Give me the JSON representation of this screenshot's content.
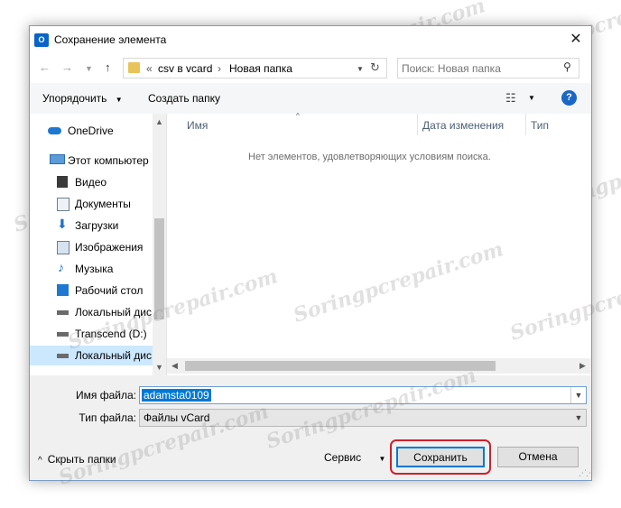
{
  "window": {
    "title": "Сохранение элемента",
    "app_icon": "O",
    "close_glyph": "✕"
  },
  "address": {
    "prefix": "«",
    "crumbs": [
      "csv в vcard",
      "Новая папка"
    ],
    "separator": "›",
    "search_placeholder": "Поиск: Новая папка"
  },
  "toolbar": {
    "organize": "Упорядочить",
    "new_folder": "Создать папку"
  },
  "sidebar": {
    "items": [
      {
        "label": "OneDrive",
        "icon": "cloud-icon"
      },
      {
        "label": "Этот компьютер",
        "icon": "computer-icon"
      },
      {
        "label": "Видео",
        "icon": "video-icon"
      },
      {
        "label": "Документы",
        "icon": "documents-icon"
      },
      {
        "label": "Загрузки",
        "icon": "download-icon"
      },
      {
        "label": "Изображения",
        "icon": "pictures-icon"
      },
      {
        "label": "Музыка",
        "icon": "music-icon"
      },
      {
        "label": "Рабочий стол",
        "icon": "desktop-icon"
      },
      {
        "label": "Локальный дис",
        "icon": "drive-icon"
      },
      {
        "label": "Transcend (D:)",
        "icon": "drive-icon"
      },
      {
        "label": "Локальный дис",
        "icon": "drive-icon"
      }
    ]
  },
  "content": {
    "columns": [
      "Имя",
      "Дата изменения",
      "Тип"
    ],
    "empty_message": "Нет элементов, удовлетворяющих условиям поиска."
  },
  "form": {
    "filename_label": "Имя файла:",
    "filename_value": "adamsta0109",
    "filetype_label": "Тип файла:",
    "filetype_value": "Файлы vCard"
  },
  "footer": {
    "hide_folders": "Скрыть папки",
    "service": "Сервис",
    "save": "Сохранить",
    "cancel": "Отмена"
  },
  "watermark": "Soringpcrepair.com",
  "colors": {
    "accent": "#0078d7",
    "highlight_ring": "#d0202a",
    "selection": "#cce8ff"
  }
}
